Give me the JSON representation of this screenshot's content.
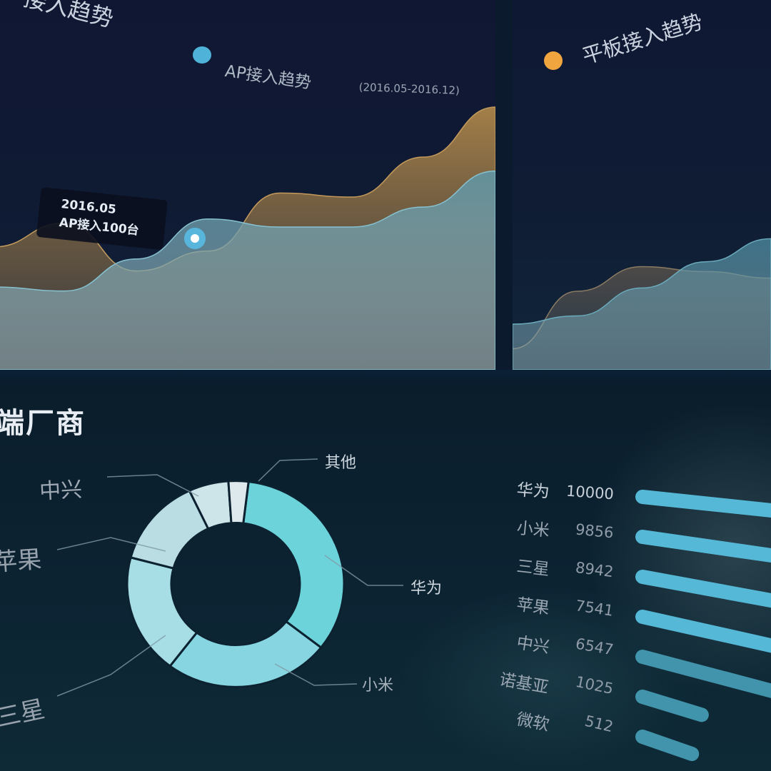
{
  "top_left": {
    "partial_title": "接入趋势",
    "legend_label": "AP接入趋势",
    "date_range": "(2016.05-2016.12)",
    "tooltip": {
      "line1": "2016.05",
      "line2": "AP接入100台"
    },
    "colors": {
      "legend_dot": "#4fb3d9",
      "area_orange": "#a4804a",
      "area_teal": "#6fa5b3"
    }
  },
  "top_right": {
    "partial_title": "平板接入趋势",
    "colors": {
      "legend_dot": "#f0a53f"
    }
  },
  "bottom": {
    "partial_title": "端厂商",
    "donut_labels": {
      "other": "其他",
      "zte": "中兴",
      "apple": "苹果",
      "huawei": "华为",
      "xiaomi": "小米",
      "samsung": "三星"
    },
    "ranking": [
      {
        "name": "华为",
        "value": "10000"
      },
      {
        "name": "小米",
        "value": "9856"
      },
      {
        "name": "三星",
        "value": "8942"
      },
      {
        "name": "苹果",
        "value": "7541"
      },
      {
        "name": "中兴",
        "value": "6547"
      },
      {
        "name": "诺基亚",
        "value": "1025"
      },
      {
        "name": "微软",
        "value": "512"
      }
    ]
  },
  "chart_data": [
    {
      "type": "area",
      "title": "AP接入趋势",
      "subtitle": "(2016.05-2016.12)",
      "series": [
        {
          "name": "",
          "values": [
            0.3,
            0.42,
            0.18,
            0.28,
            0.57,
            0.55,
            0.75,
            1.0
          ]
        },
        {
          "name": "",
          "values": [
            0.1,
            0.08,
            0.24,
            0.44,
            0.4,
            0.4,
            0.5,
            0.68
          ]
        }
      ]
    },
    {
      "type": "area",
      "title": "平板接入趋势",
      "series": [
        {
          "name": "",
          "values": [
            0.05,
            0.4,
            0.55,
            0.52,
            0.48
          ]
        },
        {
          "name": "",
          "values": [
            0.2,
            0.25,
            0.42,
            0.58,
            0.72
          ]
        }
      ]
    },
    {
      "type": "pie",
      "title": "",
      "categories": [
        "华为",
        "小米",
        "三星",
        "苹果",
        "中兴",
        "其他"
      ],
      "values": [
        34,
        25,
        19,
        14,
        6,
        3
      ]
    },
    {
      "type": "bar",
      "title": "",
      "categories": [
        "华为",
        "小米",
        "三星",
        "苹果",
        "中兴",
        "诺基亚",
        "微软"
      ],
      "values": [
        10000,
        9856,
        8942,
        7541,
        6547,
        1025,
        512
      ]
    }
  ]
}
